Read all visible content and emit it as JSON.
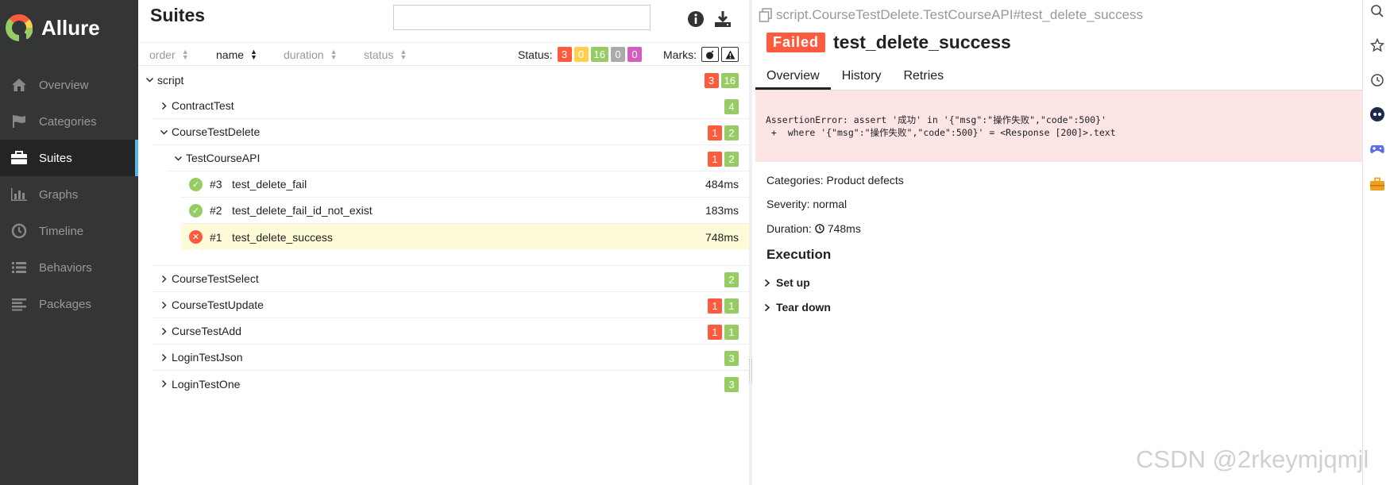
{
  "app": {
    "name": "Allure"
  },
  "sidebar": {
    "items": [
      {
        "label": "Overview",
        "icon": "home-icon"
      },
      {
        "label": "Categories",
        "icon": "flag-icon"
      },
      {
        "label": "Suites",
        "icon": "briefcase-icon",
        "active": true
      },
      {
        "label": "Graphs",
        "icon": "bar-chart-icon"
      },
      {
        "label": "Timeline",
        "icon": "clock-icon"
      },
      {
        "label": "Behaviors",
        "icon": "list-icon"
      },
      {
        "label": "Packages",
        "icon": "align-left-icon"
      }
    ]
  },
  "suites": {
    "title": "Suites",
    "search_placeholder": "",
    "sort": {
      "order": "order",
      "name": "name",
      "duration": "duration",
      "status": "status"
    },
    "status_label": "Status:",
    "status_counts": {
      "failed": "3",
      "broken": "0",
      "passed": "16",
      "skipped": "0",
      "unknown": "0"
    },
    "marks_label": "Marks:",
    "tree": {
      "script": {
        "label": "script",
        "failed": "3",
        "passed": "16"
      },
      "ContractTest": {
        "label": "ContractTest",
        "passed": "4"
      },
      "CourseTestDelete": {
        "label": "CourseTestDelete",
        "failed": "1",
        "passed": "2"
      },
      "TestCourseAPI": {
        "label": "TestCourseAPI",
        "failed": "1",
        "passed": "2"
      },
      "tests": [
        {
          "num": "#3",
          "name": "test_delete_fail",
          "duration": "484ms",
          "status": "passed"
        },
        {
          "num": "#2",
          "name": "test_delete_fail_id_not_exist",
          "duration": "183ms",
          "status": "passed"
        },
        {
          "num": "#1",
          "name": "test_delete_success",
          "duration": "748ms",
          "status": "failed"
        }
      ],
      "CourseTestSelect": {
        "label": "CourseTestSelect",
        "passed": "2"
      },
      "CourseTestUpdate": {
        "label": "CourseTestUpdate",
        "failed": "1",
        "passed": "1"
      },
      "CurseTestAdd": {
        "label": "CurseTestAdd",
        "failed": "1",
        "passed": "1"
      },
      "LoginTestJson": {
        "label": "LoginTestJson",
        "passed": "3"
      },
      "LoginTestOne": {
        "label": "LoginTestOne",
        "passed": "3"
      }
    }
  },
  "detail": {
    "path": "script.CourseTestDelete.TestCourseAPI#test_delete_success",
    "status": "Failed",
    "name": "test_delete_success",
    "tabs": [
      "Overview",
      "History",
      "Retries"
    ],
    "error_line1": "AssertionError: assert '成功' in '{\"msg\":\"操作失败\",\"code\":500}'",
    "error_line2": " +  where '{\"msg\":\"操作失败\",\"code\":500}' = <Response [200]>.text",
    "categories": "Categories: Product defects",
    "severity": "Severity: normal",
    "duration_label": "Duration:",
    "duration_value": "748ms",
    "execution": "Execution",
    "setup": "Set up",
    "teardown": "Tear down"
  },
  "watermark": "CSDN @2rkeymjqmjl",
  "colors": {
    "failed": "#fd5a3e",
    "passed": "#97cc64",
    "broken": "#ffd050",
    "skipped": "#aaaaaa",
    "unknown": "#d35ebe",
    "sidebar": "#333537"
  }
}
